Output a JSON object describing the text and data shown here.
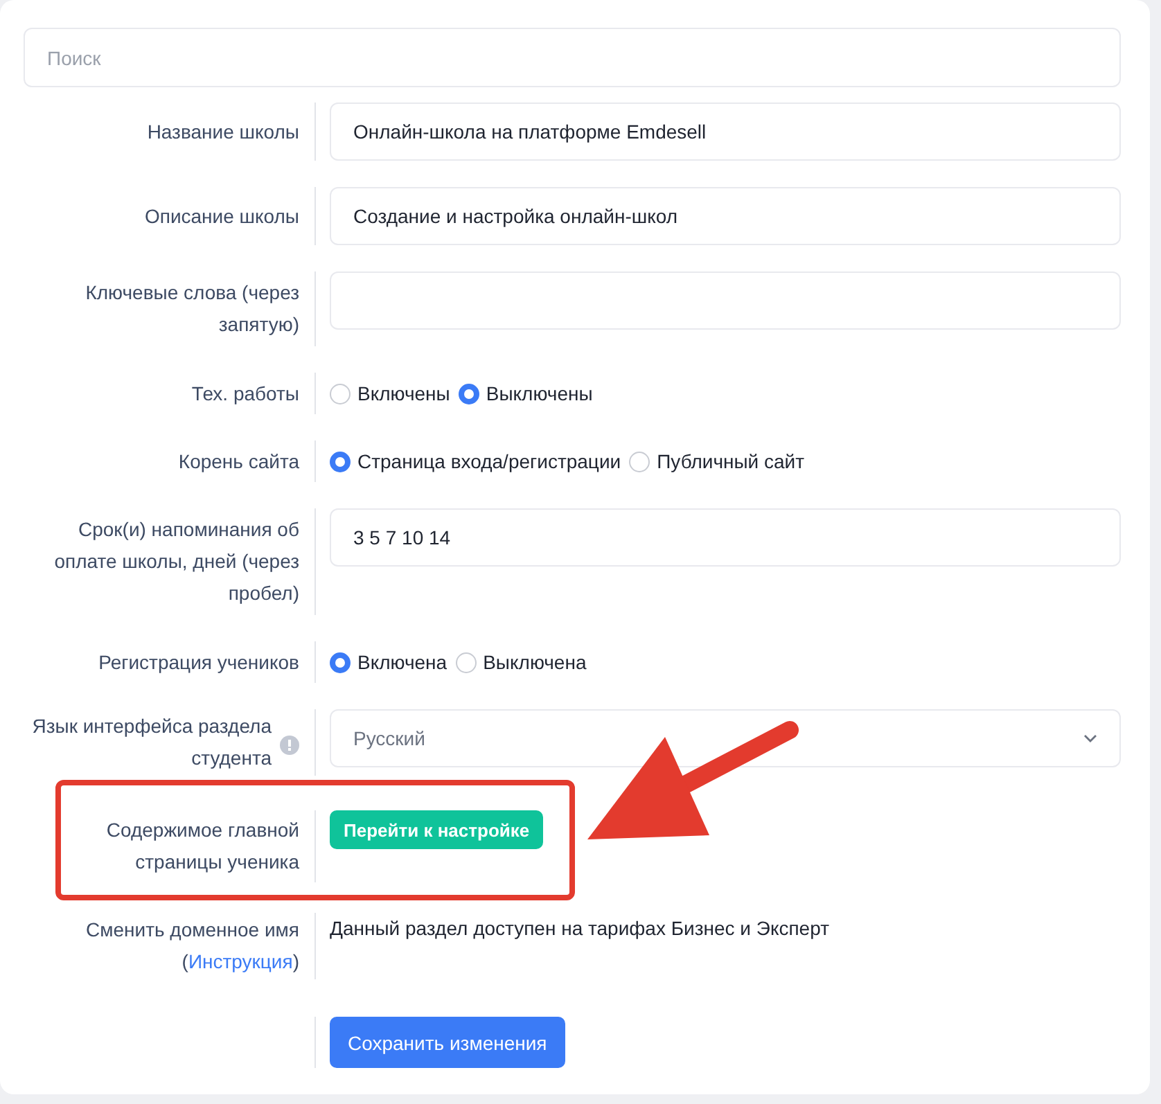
{
  "search": {
    "placeholder": "Поиск"
  },
  "rows": [
    {
      "kind": "text",
      "label": "Название школы",
      "value": "Онлайн-школа на платформе Emdesell"
    },
    {
      "kind": "text",
      "label": "Описание школы",
      "value": "Создание и настройка онлайн-школ"
    },
    {
      "kind": "text",
      "label": "Ключевые слова (через\nзапятую)",
      "value": ""
    },
    {
      "kind": "radio",
      "label": "Тех. работы",
      "options": [
        {
          "label": "Включены",
          "selected": false
        },
        {
          "label": "Выключены",
          "selected": true
        }
      ]
    },
    {
      "kind": "radio",
      "label": "Корень сайта",
      "options": [
        {
          "label": "Страница входа/регистрации",
          "selected": true
        },
        {
          "label": "Публичный сайт",
          "selected": false
        }
      ]
    },
    {
      "kind": "text",
      "label": "Срок(и) напоминания об\nоплате школы, дней (через\nпробел)",
      "value": "3 5 7 10 14"
    },
    {
      "kind": "radio",
      "label": "Регистрация учеников",
      "options": [
        {
          "label": "Включена",
          "selected": true
        },
        {
          "label": "Выключена",
          "selected": false
        }
      ]
    },
    {
      "kind": "select",
      "label": "Язык интерфейса раздела\nстудента",
      "info": true,
      "value": "Русский"
    },
    {
      "kind": "button",
      "label": "Содержимое главной\nстраницы ученика",
      "button": "Перейти к настройке",
      "highlighted": true
    },
    {
      "kind": "note",
      "label": "Сменить доменное имя",
      "label_open": "(",
      "link": "Инструкция",
      "label_close": ")",
      "note": "Данный раздел доступен на тарифах Бизнес и Эксперт"
    }
  ],
  "save_button": "Сохранить изменения"
}
